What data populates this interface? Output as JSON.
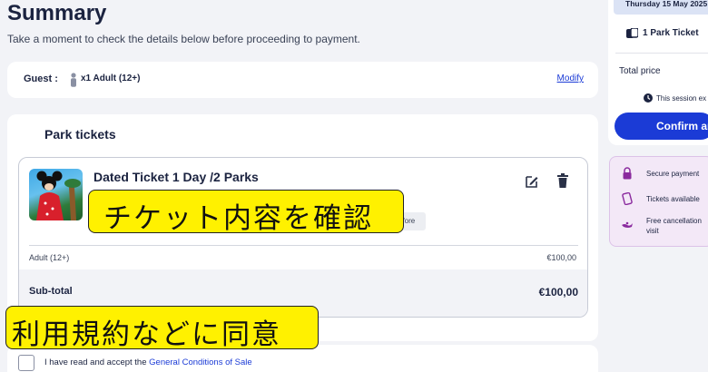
{
  "page": {
    "title": "Summary",
    "subtitle": "Take a moment to check the details below before proceeding to payment."
  },
  "guest": {
    "label": "Guest :",
    "count": "x1 Adult (12+)",
    "modify": "Modify"
  },
  "tickets": {
    "section_title": "Park tickets",
    "item": {
      "name": "Dated Ticket 1 Day /2 Parks",
      "badge": "efore",
      "line_label": "Adult (12+)",
      "line_price": "€100,00"
    },
    "subtotal_label": "Sub-total",
    "subtotal_value": "€100,00"
  },
  "overlays": {
    "ticket_caption": "チケット内容を確認",
    "terms_caption": "利用規約などに同意"
  },
  "terms": {
    "prefix": "I have read and accept the ",
    "link": "General Conditions of Sale"
  },
  "sidebar": {
    "date": "Thursday 15 May 2025",
    "ticket_count": "1 Park Ticket",
    "total_label": "Total price",
    "session_text": "This session ex",
    "confirm_label": "Confirm an",
    "benefits": [
      {
        "icon": "lock-icon",
        "text": "Secure payment"
      },
      {
        "icon": "phone-ticket-icon",
        "text": "Tickets available"
      },
      {
        "icon": "magic-lamp-icon",
        "text_line1": "Free cancellation",
        "text_line2": "visit"
      }
    ]
  },
  "colors": {
    "accent": "#1b3bd6",
    "highlight": "#fff100",
    "background": "#f2f3f7",
    "benefits_bg": "#f3e8f7"
  }
}
